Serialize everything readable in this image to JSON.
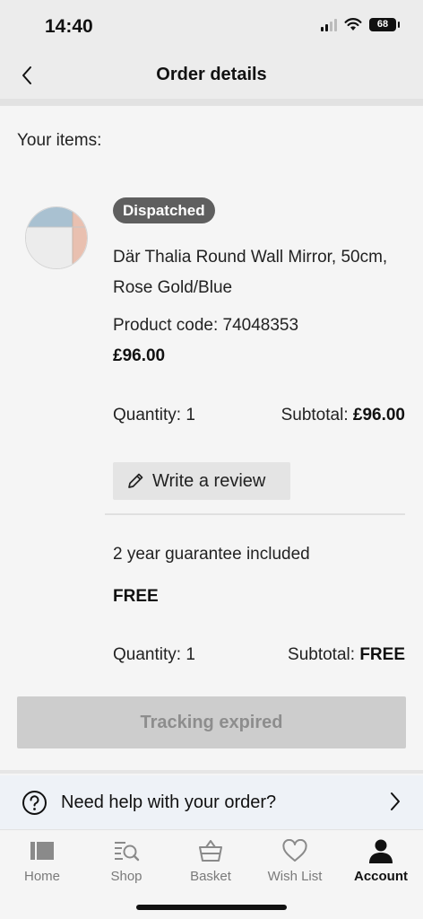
{
  "status_bar": {
    "time": "14:40",
    "battery": "68"
  },
  "header": {
    "title": "Order details",
    "back_icon": "chevron-left-icon"
  },
  "order": {
    "section_label": "Your items:",
    "items": [
      {
        "status": "Dispatched",
        "name": "Där Thalia Round Wall Mirror, 50cm, Rose Gold/Blue",
        "product_code": "Product code: 74048353",
        "price": "£96.00",
        "quantity_label": "Quantity: 1",
        "subtotal_label": "Subtotal:",
        "subtotal_value": "£96.00",
        "review_button": "Write a review",
        "review_icon": "pencil-icon"
      }
    ],
    "addon": {
      "name": "2 year guarantee included",
      "price": "FREE",
      "quantity_label": "Quantity: 1",
      "subtotal_label": "Subtotal:",
      "subtotal_value": "FREE"
    },
    "tracking_button": "Tracking expired"
  },
  "help": {
    "text": "Need help with your order?",
    "icon": "question-circle-icon"
  },
  "tab_bar": {
    "tabs": [
      {
        "label": "Home",
        "icon": "home-icon"
      },
      {
        "label": "Shop",
        "icon": "shop-search-icon"
      },
      {
        "label": "Basket",
        "icon": "basket-icon"
      },
      {
        "label": "Wish List",
        "icon": "heart-icon"
      },
      {
        "label": "Account",
        "icon": "account-icon",
        "active": true
      }
    ]
  },
  "colors": {
    "badge_bg": "#5f5f5f",
    "tracking_disabled_bg": "#cdcdcd",
    "help_row_bg": "#eef2f7"
  }
}
